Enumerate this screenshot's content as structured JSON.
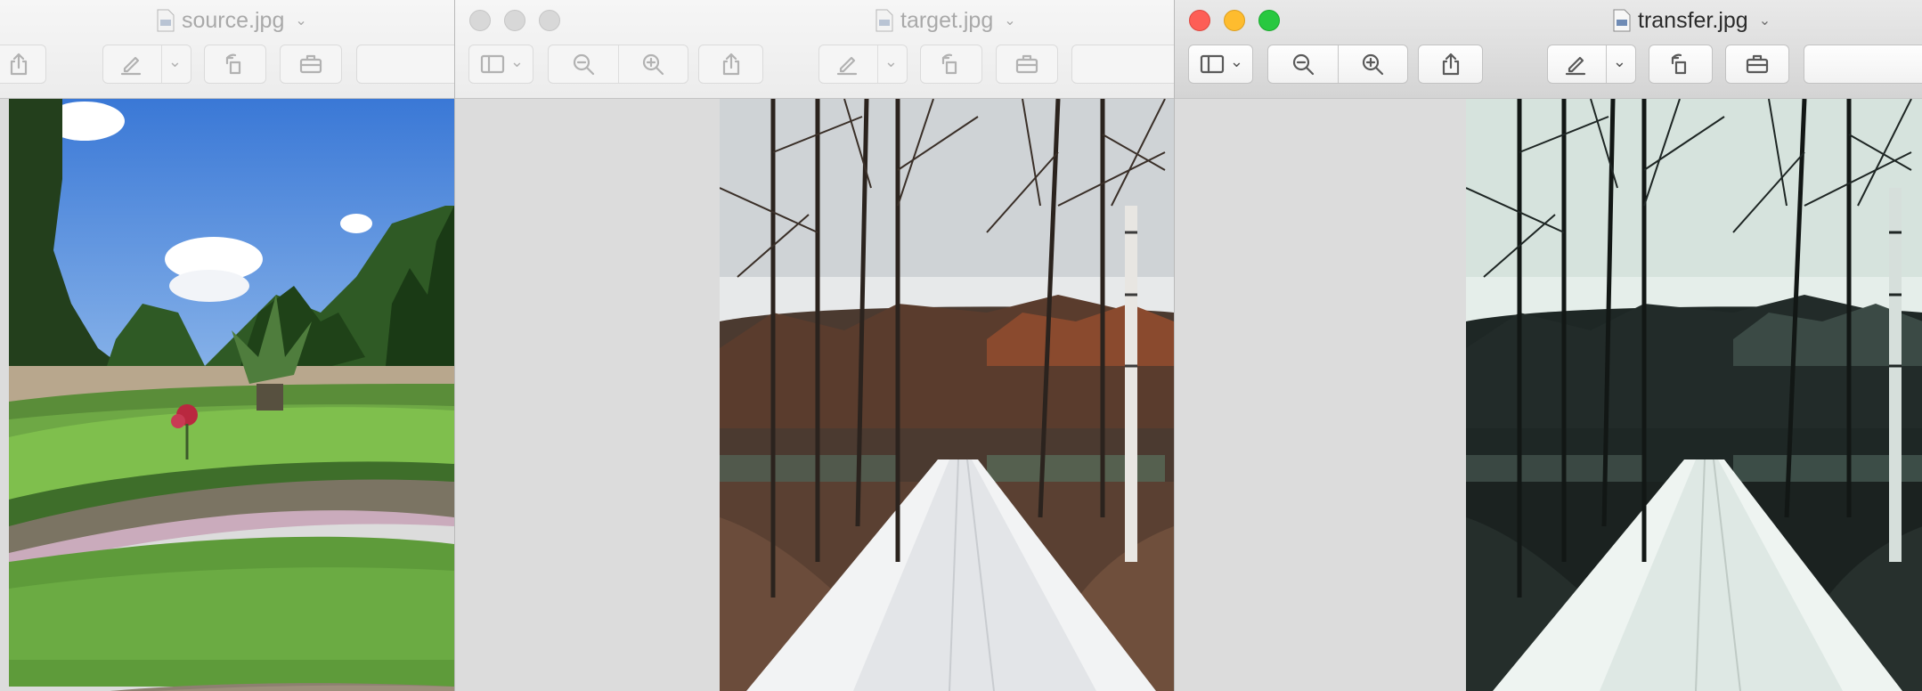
{
  "windows": [
    {
      "id": "source",
      "filename": "source.jpg",
      "active": false,
      "image_desc_icon": "photo-garden"
    },
    {
      "id": "target",
      "filename": "target.jpg",
      "active": false,
      "image_desc_icon": "photo-winter-path"
    },
    {
      "id": "transfer",
      "filename": "transfer.jpg",
      "active": true,
      "image_desc_icon": "photo-winter-path-teal"
    }
  ],
  "toolbar_icons": [
    "sidebar-icon",
    "zoom-out-icon",
    "zoom-in-icon",
    "share-icon",
    "markup-pen-icon",
    "rotate-icon",
    "toolbox-icon"
  ],
  "colors": {
    "close": "#fd5e56",
    "minimize": "#febc2e",
    "zoom": "#28c840"
  }
}
